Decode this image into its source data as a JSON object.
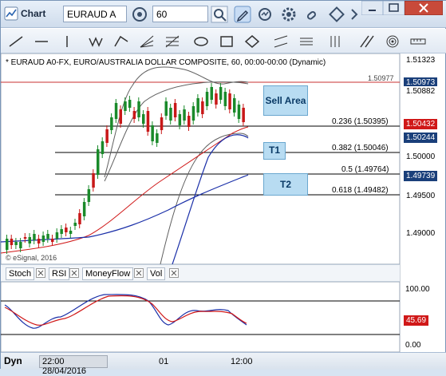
{
  "titlebar": {
    "title": "Chart",
    "symbol": "EURAUD A",
    "interval": "60"
  },
  "chart": {
    "header": "* EURAUD A0-FX, EURO/AUSTRALIA DOLLAR COMPOSITE, 60, 00:00-00:00 (Dynamic)",
    "watermark": "© eSignal, 2016",
    "high_marker": "1.50977",
    "price_tags": [
      {
        "label": "1.51323",
        "bg": "#ffffff",
        "fg": "#000000"
      },
      {
        "label": "1.50973",
        "bg": "#1a3f7a",
        "fg": "#ffffff"
      },
      {
        "label": "1.50882",
        "bg": "#ffffff",
        "fg": "#000000"
      },
      {
        "label": "1.50432",
        "bg": "#d01818",
        "fg": "#ffffff"
      },
      {
        "label": "1.50244",
        "bg": "#1a3f7a",
        "fg": "#ffffff"
      },
      {
        "label": "1.50000",
        "bg": "#ffffff",
        "fg": "#000000"
      },
      {
        "label": "1.49739",
        "bg": "#1a3f7a",
        "fg": "#ffffff"
      },
      {
        "label": "1.49500",
        "bg": "#ffffff",
        "fg": "#000000"
      },
      {
        "label": "1.49000",
        "bg": "#ffffff",
        "fg": "#000000"
      }
    ],
    "fib_levels": [
      {
        "label": "0.236 (1.50395)"
      },
      {
        "label": "0.382 (1.50046)"
      },
      {
        "label": "0.5 (1.49764)"
      },
      {
        "label": "0.618 (1.49482)"
      }
    ],
    "zones": {
      "sell": "Sell Area",
      "t1": "T1",
      "t2": "T2"
    }
  },
  "tabs": [
    "Stoch",
    "RSI",
    "MoneyFlow",
    "Vol"
  ],
  "stoch": {
    "axis": [
      "100.00",
      "0.00"
    ],
    "value": "45.69"
  },
  "bottom": {
    "mode": "Dyn",
    "date": "22:00 28/04/2016",
    "times": [
      "01",
      "12:00"
    ]
  },
  "colors": {
    "up_candle": "#1a8a2a",
    "down_candle": "#c81818",
    "ma_red": "#d01818",
    "ma_blue": "#1a2fa8",
    "bollinger": "#606060",
    "fib_line": "#000000"
  },
  "icons": [
    "chart-icon",
    "settings-icon",
    "dropdown-icon",
    "pencil-icon",
    "refresh-icon",
    "gear-icon",
    "link-icon"
  ]
}
